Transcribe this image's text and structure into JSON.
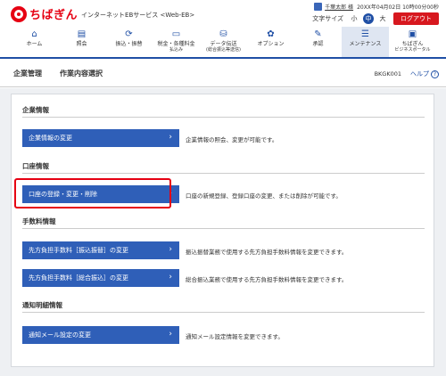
{
  "header": {
    "brand": "ちばぎん",
    "service": "インターネットEBサービス  <Web-EB>",
    "user_name": "千葉太郎 様",
    "last_login": "20XX年04月02日 10時00分00秒",
    "font_size_label": "文字サイズ",
    "font_sizes": [
      "小",
      "中",
      "大"
    ],
    "logout": "ログアウト"
  },
  "nav": {
    "items": [
      {
        "label": "ホーム",
        "icon": "home-icon"
      },
      {
        "label": "照会",
        "icon": "inquiry-icon"
      },
      {
        "label": "振込・振替",
        "icon": "transfer-icon"
      },
      {
        "label": "税金・各種料金",
        "sub": "払込み",
        "icon": "tax-payment-icon"
      },
      {
        "label": "データ伝送",
        "sub": "(総合振込等送信)",
        "icon": "data-transfer-icon"
      },
      {
        "label": "オプション",
        "icon": "option-icon"
      },
      {
        "label": "承認",
        "icon": "approval-icon"
      },
      {
        "label": "メンテナンス",
        "icon": "maintenance-icon",
        "active": true
      },
      {
        "label": "ちばぎん",
        "sub": "ビジネスポータル",
        "icon": "portal-icon"
      }
    ]
  },
  "page": {
    "crumb1": "企業管理",
    "crumb2": "作業内容選択",
    "screen_id": "BKGK001",
    "help": "ヘルプ"
  },
  "sections": {
    "corp": {
      "title": "企業情報",
      "btn": "企業情報の変更",
      "desc": "企業情報の照会、変更が可能です。"
    },
    "account": {
      "title": "口座情報",
      "btn": "口座の登録・変更・削除",
      "desc": "口座の新規登録、登録口座の変更、または削除が可能です。"
    },
    "fee": {
      "title": "手数料情報",
      "btn1": "先方負担手数料［振込振替］の変更",
      "desc1": "振込振替業務で使用する先方負担手数料情報を変更できます。",
      "btn2": "先方負担手数料［総合振込］の変更",
      "desc2": "総合振込業務で使用する先方負担手数料情報を変更できます。"
    },
    "notice": {
      "title": "通知明細情報",
      "btn": "通知メール設定の変更",
      "desc": "通知メール設定情報を変更できます。"
    }
  }
}
